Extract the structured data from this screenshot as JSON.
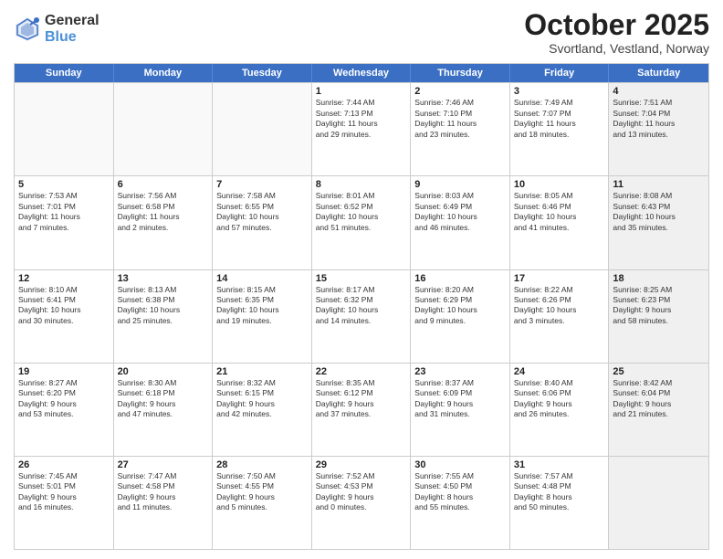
{
  "logo": {
    "general": "General",
    "blue": "Blue"
  },
  "header": {
    "month": "October 2025",
    "location": "Svortland, Vestland, Norway"
  },
  "weekdays": [
    "Sunday",
    "Monday",
    "Tuesday",
    "Wednesday",
    "Thursday",
    "Friday",
    "Saturday"
  ],
  "rows": [
    [
      {
        "day": "",
        "empty": true
      },
      {
        "day": "",
        "empty": true
      },
      {
        "day": "",
        "empty": true
      },
      {
        "day": "1",
        "lines": [
          "Sunrise: 7:44 AM",
          "Sunset: 7:13 PM",
          "Daylight: 11 hours",
          "and 29 minutes."
        ]
      },
      {
        "day": "2",
        "lines": [
          "Sunrise: 7:46 AM",
          "Sunset: 7:10 PM",
          "Daylight: 11 hours",
          "and 23 minutes."
        ]
      },
      {
        "day": "3",
        "lines": [
          "Sunrise: 7:49 AM",
          "Sunset: 7:07 PM",
          "Daylight: 11 hours",
          "and 18 minutes."
        ]
      },
      {
        "day": "4",
        "lines": [
          "Sunrise: 7:51 AM",
          "Sunset: 7:04 PM",
          "Daylight: 11 hours",
          "and 13 minutes."
        ],
        "shaded": true
      }
    ],
    [
      {
        "day": "5",
        "lines": [
          "Sunrise: 7:53 AM",
          "Sunset: 7:01 PM",
          "Daylight: 11 hours",
          "and 7 minutes."
        ]
      },
      {
        "day": "6",
        "lines": [
          "Sunrise: 7:56 AM",
          "Sunset: 6:58 PM",
          "Daylight: 11 hours",
          "and 2 minutes."
        ]
      },
      {
        "day": "7",
        "lines": [
          "Sunrise: 7:58 AM",
          "Sunset: 6:55 PM",
          "Daylight: 10 hours",
          "and 57 minutes."
        ]
      },
      {
        "day": "8",
        "lines": [
          "Sunrise: 8:01 AM",
          "Sunset: 6:52 PM",
          "Daylight: 10 hours",
          "and 51 minutes."
        ]
      },
      {
        "day": "9",
        "lines": [
          "Sunrise: 8:03 AM",
          "Sunset: 6:49 PM",
          "Daylight: 10 hours",
          "and 46 minutes."
        ]
      },
      {
        "day": "10",
        "lines": [
          "Sunrise: 8:05 AM",
          "Sunset: 6:46 PM",
          "Daylight: 10 hours",
          "and 41 minutes."
        ]
      },
      {
        "day": "11",
        "lines": [
          "Sunrise: 8:08 AM",
          "Sunset: 6:43 PM",
          "Daylight: 10 hours",
          "and 35 minutes."
        ],
        "shaded": true
      }
    ],
    [
      {
        "day": "12",
        "lines": [
          "Sunrise: 8:10 AM",
          "Sunset: 6:41 PM",
          "Daylight: 10 hours",
          "and 30 minutes."
        ]
      },
      {
        "day": "13",
        "lines": [
          "Sunrise: 8:13 AM",
          "Sunset: 6:38 PM",
          "Daylight: 10 hours",
          "and 25 minutes."
        ]
      },
      {
        "day": "14",
        "lines": [
          "Sunrise: 8:15 AM",
          "Sunset: 6:35 PM",
          "Daylight: 10 hours",
          "and 19 minutes."
        ]
      },
      {
        "day": "15",
        "lines": [
          "Sunrise: 8:17 AM",
          "Sunset: 6:32 PM",
          "Daylight: 10 hours",
          "and 14 minutes."
        ]
      },
      {
        "day": "16",
        "lines": [
          "Sunrise: 8:20 AM",
          "Sunset: 6:29 PM",
          "Daylight: 10 hours",
          "and 9 minutes."
        ]
      },
      {
        "day": "17",
        "lines": [
          "Sunrise: 8:22 AM",
          "Sunset: 6:26 PM",
          "Daylight: 10 hours",
          "and 3 minutes."
        ]
      },
      {
        "day": "18",
        "lines": [
          "Sunrise: 8:25 AM",
          "Sunset: 6:23 PM",
          "Daylight: 9 hours",
          "and 58 minutes."
        ],
        "shaded": true
      }
    ],
    [
      {
        "day": "19",
        "lines": [
          "Sunrise: 8:27 AM",
          "Sunset: 6:20 PM",
          "Daylight: 9 hours",
          "and 53 minutes."
        ]
      },
      {
        "day": "20",
        "lines": [
          "Sunrise: 8:30 AM",
          "Sunset: 6:18 PM",
          "Daylight: 9 hours",
          "and 47 minutes."
        ]
      },
      {
        "day": "21",
        "lines": [
          "Sunrise: 8:32 AM",
          "Sunset: 6:15 PM",
          "Daylight: 9 hours",
          "and 42 minutes."
        ]
      },
      {
        "day": "22",
        "lines": [
          "Sunrise: 8:35 AM",
          "Sunset: 6:12 PM",
          "Daylight: 9 hours",
          "and 37 minutes."
        ]
      },
      {
        "day": "23",
        "lines": [
          "Sunrise: 8:37 AM",
          "Sunset: 6:09 PM",
          "Daylight: 9 hours",
          "and 31 minutes."
        ]
      },
      {
        "day": "24",
        "lines": [
          "Sunrise: 8:40 AM",
          "Sunset: 6:06 PM",
          "Daylight: 9 hours",
          "and 26 minutes."
        ]
      },
      {
        "day": "25",
        "lines": [
          "Sunrise: 8:42 AM",
          "Sunset: 6:04 PM",
          "Daylight: 9 hours",
          "and 21 minutes."
        ],
        "shaded": true
      }
    ],
    [
      {
        "day": "26",
        "lines": [
          "Sunrise: 7:45 AM",
          "Sunset: 5:01 PM",
          "Daylight: 9 hours",
          "and 16 minutes."
        ]
      },
      {
        "day": "27",
        "lines": [
          "Sunrise: 7:47 AM",
          "Sunset: 4:58 PM",
          "Daylight: 9 hours",
          "and 11 minutes."
        ]
      },
      {
        "day": "28",
        "lines": [
          "Sunrise: 7:50 AM",
          "Sunset: 4:55 PM",
          "Daylight: 9 hours",
          "and 5 minutes."
        ]
      },
      {
        "day": "29",
        "lines": [
          "Sunrise: 7:52 AM",
          "Sunset: 4:53 PM",
          "Daylight: 9 hours",
          "and 0 minutes."
        ]
      },
      {
        "day": "30",
        "lines": [
          "Sunrise: 7:55 AM",
          "Sunset: 4:50 PM",
          "Daylight: 8 hours",
          "and 55 minutes."
        ]
      },
      {
        "day": "31",
        "lines": [
          "Sunrise: 7:57 AM",
          "Sunset: 4:48 PM",
          "Daylight: 8 hours",
          "and 50 minutes."
        ]
      },
      {
        "day": "",
        "empty": true,
        "shaded": true
      }
    ]
  ]
}
